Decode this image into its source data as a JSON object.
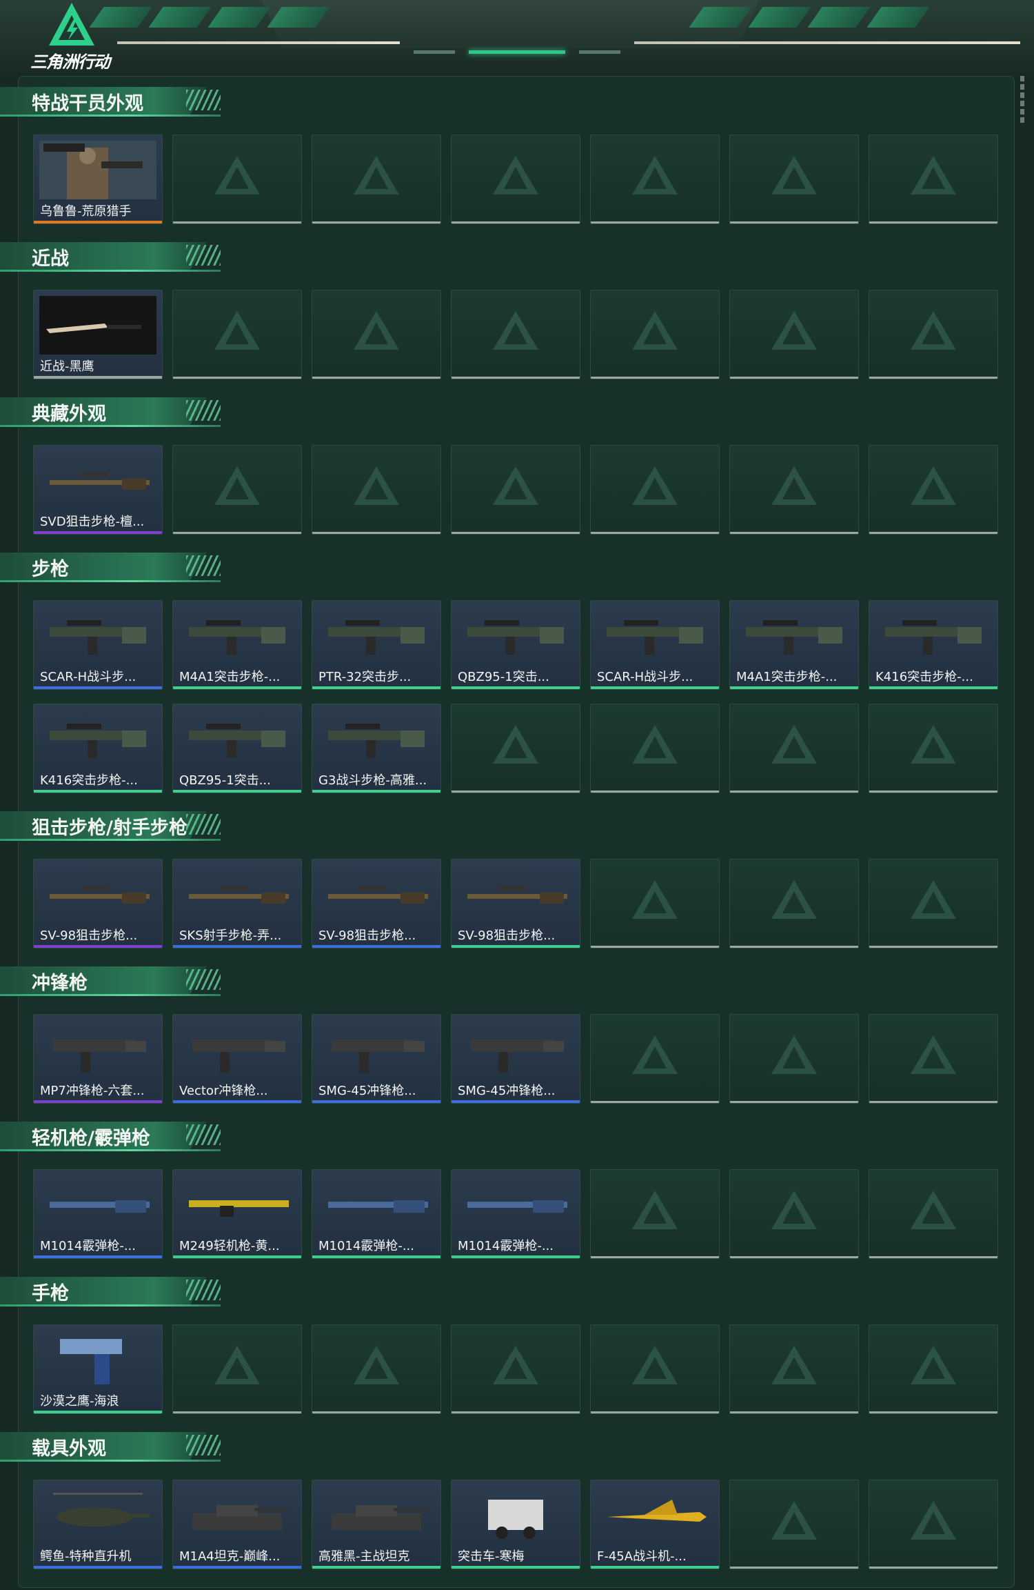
{
  "app": {
    "logo_text": "三角洲行动"
  },
  "colors": {
    "orange": "#e07a22",
    "purple": "#7c3fd0",
    "blue": "#3b6fe0",
    "green": "#3ccf8e",
    "empty": "#9aa7a2"
  },
  "sections": [
    {
      "title": "特战干员外观",
      "rows": 1,
      "items": [
        {
          "label": "乌鲁鲁-荒原猎手",
          "rarity": "orange",
          "icon": "operator-portrait-icon"
        }
      ]
    },
    {
      "title": "近战",
      "rows": 1,
      "items": [
        {
          "label": "近战-黑鹰",
          "rarity": "empty",
          "icon": "knife-icon"
        }
      ]
    },
    {
      "title": "典藏外观",
      "rows": 1,
      "items": [
        {
          "label": "SVD狙击步枪-檀...",
          "rarity": "purple",
          "icon": "sniper-rifle-icon"
        }
      ]
    },
    {
      "title": "步枪",
      "rows": 2,
      "items": [
        {
          "label": "SCAR-H战斗步...",
          "rarity": "blue",
          "icon": "rifle-icon"
        },
        {
          "label": "M4A1突击步枪-...",
          "rarity": "green",
          "icon": "rifle-icon"
        },
        {
          "label": "PTR-32突击步...",
          "rarity": "green",
          "icon": "rifle-icon"
        },
        {
          "label": "QBZ95-1突击...",
          "rarity": "green",
          "icon": "rifle-icon"
        },
        {
          "label": "SCAR-H战斗步...",
          "rarity": "green",
          "icon": "rifle-icon"
        },
        {
          "label": "M4A1突击步枪-...",
          "rarity": "green",
          "icon": "rifle-icon"
        },
        {
          "label": "K416突击步枪-...",
          "rarity": "green",
          "icon": "rifle-icon"
        },
        {
          "label": "K416突击步枪-...",
          "rarity": "green",
          "icon": "rifle-icon"
        },
        {
          "label": "QBZ95-1突击...",
          "rarity": "green",
          "icon": "rifle-icon"
        },
        {
          "label": "G3战斗步枪-高雅...",
          "rarity": "green",
          "icon": "rifle-icon"
        }
      ]
    },
    {
      "title": "狙击步枪/射手步枪",
      "rows": 1,
      "items": [
        {
          "label": "SV-98狙击步枪...",
          "rarity": "purple",
          "icon": "sniper-rifle-icon"
        },
        {
          "label": "SKS射手步枪-弄...",
          "rarity": "blue",
          "icon": "sniper-rifle-icon"
        },
        {
          "label": "SV-98狙击步枪...",
          "rarity": "blue",
          "icon": "sniper-rifle-icon"
        },
        {
          "label": "SV-98狙击步枪...",
          "rarity": "green",
          "icon": "sniper-rifle-icon"
        }
      ]
    },
    {
      "title": "冲锋枪",
      "rows": 1,
      "items": [
        {
          "label": "MP7冲锋枪-六套...",
          "rarity": "purple",
          "icon": "smg-icon"
        },
        {
          "label": "Vector冲锋枪...",
          "rarity": "blue",
          "icon": "smg-icon"
        },
        {
          "label": "SMG-45冲锋枪...",
          "rarity": "blue",
          "icon": "smg-icon"
        },
        {
          "label": "SMG-45冲锋枪...",
          "rarity": "blue",
          "icon": "smg-icon"
        }
      ]
    },
    {
      "title": "轻机枪/霰弹枪",
      "rows": 1,
      "items": [
        {
          "label": "M1014霰弹枪-...",
          "rarity": "blue",
          "icon": "shotgun-icon"
        },
        {
          "label": "M249轻机枪-黄...",
          "rarity": "green",
          "icon": "machine-gun-icon"
        },
        {
          "label": "M1014霰弹枪-...",
          "rarity": "green",
          "icon": "shotgun-icon"
        },
        {
          "label": "M1014霰弹枪-...",
          "rarity": "green",
          "icon": "shotgun-icon"
        }
      ]
    },
    {
      "title": "手枪",
      "rows": 1,
      "items": [
        {
          "label": "沙漠之鹰-海浪",
          "rarity": "green",
          "icon": "pistol-icon"
        }
      ]
    },
    {
      "title": "载具外观",
      "rows": 1,
      "items": [
        {
          "label": "鳄鱼-特种直升机",
          "rarity": "blue",
          "icon": "helicopter-icon"
        },
        {
          "label": "M1A4坦克-巅峰...",
          "rarity": "blue",
          "icon": "tank-icon"
        },
        {
          "label": "高雅黑-主战坦克",
          "rarity": "green",
          "icon": "tank-icon"
        },
        {
          "label": "突击车-寒梅",
          "rarity": "green",
          "icon": "armored-car-icon"
        },
        {
          "label": "F-45A战斗机-...",
          "rarity": "green",
          "icon": "jet-fighter-icon"
        }
      ]
    }
  ]
}
